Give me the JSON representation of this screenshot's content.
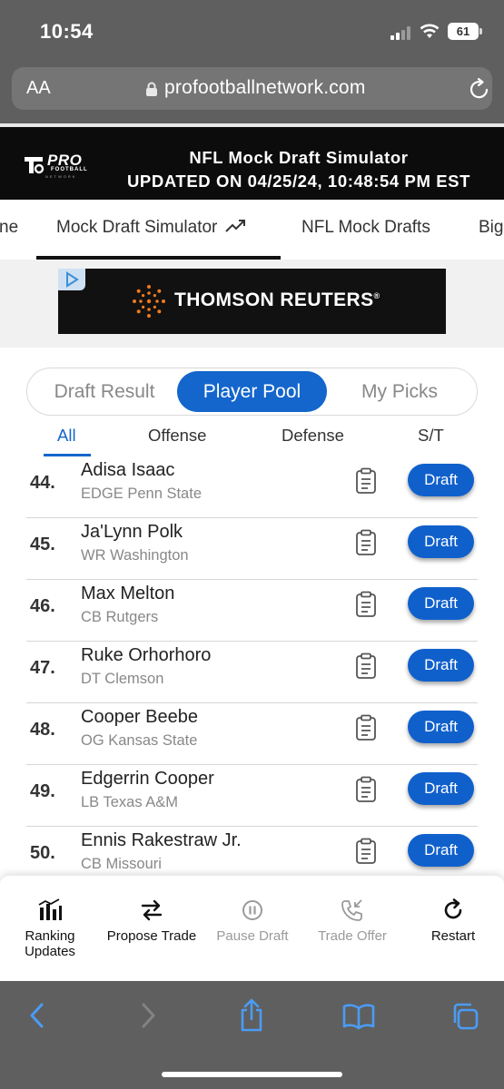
{
  "status_bar": {
    "time": "10:54",
    "battery": "61"
  },
  "browser": {
    "text_size_label": "AA",
    "domain": "profootballnetwork.com"
  },
  "site_header": {
    "logo_text": "PRO",
    "logo_sub": "FOOTBALL",
    "logo_sub2": "NETWORK",
    "title": "NFL Mock Draft Simulator",
    "updated": "UPDATED ON 04/25/24, 10:48:54 PM EST"
  },
  "nav_tabs": [
    {
      "label": "ne"
    },
    {
      "label": "Mock Draft Simulator"
    },
    {
      "label": "NFL Mock Drafts"
    },
    {
      "label": "Big"
    }
  ],
  "ad": {
    "brand": "THOMSON REUTERS",
    "reg": "®"
  },
  "segments": [
    {
      "label": "Draft Result",
      "active": false
    },
    {
      "label": "Player Pool",
      "active": true
    },
    {
      "label": "My Picks",
      "active": false
    }
  ],
  "sub_tabs": [
    {
      "label": "All",
      "active": true
    },
    {
      "label": "Offense",
      "active": false
    },
    {
      "label": "Defense",
      "active": false
    },
    {
      "label": "S/T",
      "active": false
    }
  ],
  "players": [
    {
      "rank": "44.",
      "name": "Adisa Isaac",
      "info": "EDGE Penn State",
      "action": "Draft"
    },
    {
      "rank": "45.",
      "name": "Ja'Lynn Polk",
      "info": "WR Washington",
      "action": "Draft"
    },
    {
      "rank": "46.",
      "name": "Max Melton",
      "info": "CB Rutgers",
      "action": "Draft"
    },
    {
      "rank": "47.",
      "name": "Ruke Orhorhoro",
      "info": "DT Clemson",
      "action": "Draft"
    },
    {
      "rank": "48.",
      "name": "Cooper Beebe",
      "info": "OG Kansas State",
      "action": "Draft"
    },
    {
      "rank": "49.",
      "name": "Edgerrin Cooper",
      "info": "LB Texas A&M",
      "action": "Draft"
    },
    {
      "rank": "50.",
      "name": "Ennis Rakestraw Jr.",
      "info": "CB Missouri",
      "action": "Draft"
    }
  ],
  "actions": [
    {
      "label_line1": "Ranking",
      "label_line2": "Updates",
      "icon": "chart-icon",
      "enabled": true
    },
    {
      "label": "Propose Trade",
      "icon": "swap-arrows-icon",
      "enabled": true
    },
    {
      "label": "Pause Draft",
      "icon": "pause-icon",
      "enabled": false
    },
    {
      "label": "Trade Offer",
      "icon": "phone-incoming-icon",
      "enabled": false
    },
    {
      "label": "Restart",
      "icon": "restart-icon",
      "enabled": true
    }
  ],
  "colors": {
    "accent": "#1466cc",
    "header_bg": "#0c0c0c",
    "browser_chrome": "#5f5f5f"
  }
}
